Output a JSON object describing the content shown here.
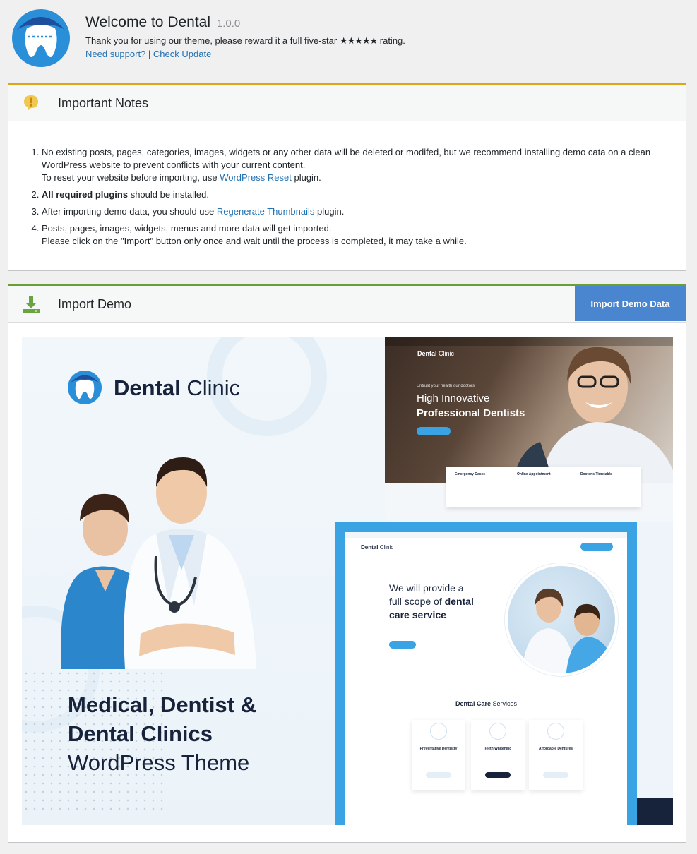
{
  "header": {
    "title": "Welcome to Dental",
    "version": "1.0.0",
    "message_before": "Thank you for using our theme, please reward it a full five-star",
    "stars": "★★★★★",
    "message_after": "rating.",
    "support_link": "Need support?",
    "separator": "|",
    "update_link": "Check Update"
  },
  "notes": {
    "title": "Important Notes",
    "items": [
      {
        "text_before": "No existing posts, pages, categories, images, widgets or any other data will be deleted or modifed, but we recommend installing demo cata on a clean WordPress website to prevent conflicts with your current content.",
        "line2_before": "To reset your website before importing, use",
        "link": "WordPress Reset",
        "line2_after": "plugin."
      },
      {
        "bold": "All required plugins",
        "text_after": "should be installed."
      },
      {
        "text_before": "After importing demo data, you should use",
        "link": "Regenerate Thumbnails",
        "text_after": "plugin."
      },
      {
        "text_before": "Posts, pages, images, widgets, menus and more data will get imported.",
        "line2": "Please click on the \"Import\" button only once and wait until the process is completed, it may take a while."
      }
    ]
  },
  "import": {
    "title": "Import Demo",
    "button": "Import Demo Data"
  },
  "preview": {
    "brand_bold": "Dental",
    "brand_light": "Clinic",
    "headline_1": "Medical, Dentist &",
    "headline_2": "Dental Clinics",
    "headline_3": "WordPress Theme",
    "hero_kicker": "Entrust your health our doctors",
    "hero_line1": "High Innovative",
    "hero_line2": "Professional Dentists",
    "info_cards": [
      "Emergency Cases",
      "Online Appointment",
      "Doctor's Timetable"
    ],
    "mock_line1": "We will provide a",
    "mock_line2": "full scope of",
    "mock_line2_bold": "dental",
    "mock_line3": "care service",
    "services_bold": "Dental Care",
    "services_light": "Services",
    "services": [
      "Preventative Dentistry",
      "Teeth Whitening",
      "Affordable Dentures"
    ]
  },
  "colors": {
    "accent_blue": "#4a86d0",
    "link": "#2271b1",
    "notes_border": "#dba617",
    "import_border": "#68a036",
    "navy": "#17223b",
    "sky": "#3aa3e3"
  }
}
